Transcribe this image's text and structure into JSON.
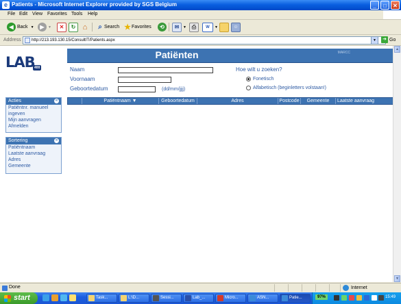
{
  "window": {
    "title": "Patients - Microsoft Internet Explorer provided by SGS Belgium",
    "buttons": {
      "minimize": "_",
      "maximize": "□",
      "close": "✕"
    }
  },
  "menu": [
    "File",
    "Edit",
    "View",
    "Favorites",
    "Tools",
    "Help"
  ],
  "toolbar": {
    "back": "Back",
    "search": "Search",
    "favorites": "Favorites"
  },
  "address": {
    "label": "Address",
    "url": "http://213.193.130.15/ConsultIT/Patients.aspx",
    "go": "Go"
  },
  "page": {
    "logo": {
      "text": "LAB",
      "badge": "400"
    },
    "header_title": "Patiënten",
    "header_user": "MARCC",
    "form": {
      "naam_label": "Naam",
      "voornaam_label": "Voornaam",
      "geboortedatum_label": "Geboortedatum",
      "date_format": "(dd/mm/jjjj)",
      "naam_value": "",
      "voornaam_value": "",
      "geboortedatum_value": ""
    },
    "search_mode": {
      "question": "Hoe wilt u zoeken?",
      "options": [
        "Fonetisch",
        "Alfabetisch (beginletters volstaan!)"
      ],
      "selected": "Fonetisch"
    },
    "acties": {
      "title": "Acties",
      "items": [
        "Patiëntnr. manueel ingeven",
        "Mijn aanvragen",
        "Afmelden"
      ]
    },
    "sortering": {
      "title": "Sortering",
      "items": [
        "Patiëntnaam",
        "Laatste aanvraag",
        "Adres",
        "Gemeente"
      ]
    },
    "table": {
      "columns": [
        "Patiëntnaam ▼",
        "Geboortedatum",
        "Adres",
        "Postcode",
        "Gemeente",
        "Laatste aanvraag"
      ]
    }
  },
  "status": {
    "text": "Done",
    "zone": "Internet"
  },
  "taskbar": {
    "start": "start",
    "tasks": [
      "Task...",
      "L:\\D...",
      "Sessi...",
      "Lab_...",
      "Micro...",
      "ASN...",
      "Patie..."
    ],
    "active_task": "Patie...",
    "battery": "97%",
    "clock": "15:49"
  },
  "colors": {
    "accent": "#3d73b2",
    "link": "#2d5aa3",
    "titlebar": "#0a5fe0"
  }
}
